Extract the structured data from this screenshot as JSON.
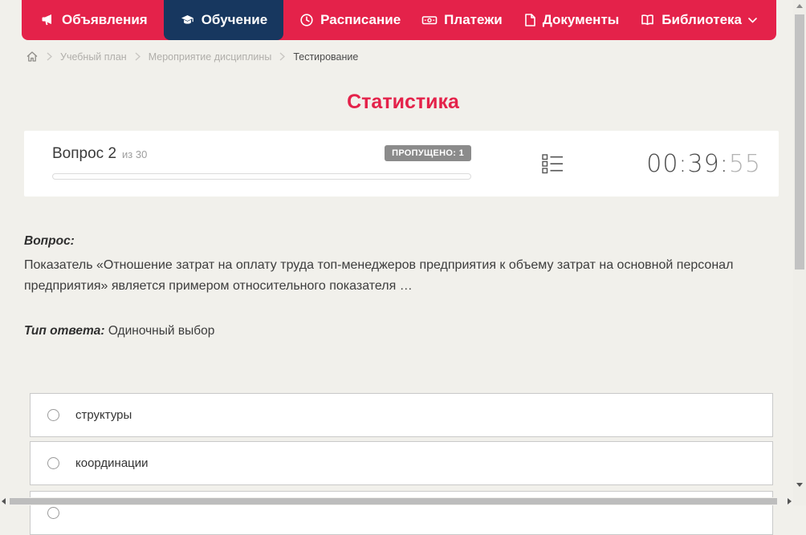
{
  "colors": {
    "accent_red": "#e4224a",
    "active_nav_navy": "#17375f",
    "badge_gray": "#8b8b8b",
    "page_bg": "#f1f0eb"
  },
  "nav": {
    "items": [
      {
        "label": "Объявления",
        "icon": "megaphone-icon",
        "active": false
      },
      {
        "label": "Обучение",
        "icon": "graduation-cap-icon",
        "active": true
      },
      {
        "label": "Расписание",
        "icon": "clock-icon",
        "active": false
      },
      {
        "label": "Платежи",
        "icon": "cash-icon",
        "active": false
      },
      {
        "label": "Документы",
        "icon": "document-icon",
        "active": false
      },
      {
        "label": "Библиотека",
        "icon": "book-icon",
        "active": false,
        "has_dropdown": true
      }
    ]
  },
  "breadcrumb": {
    "items": [
      {
        "label": "Учебный план",
        "current": false
      },
      {
        "label": "Мероприятие дисциплины",
        "current": false
      },
      {
        "label": "Тестирование",
        "current": true
      }
    ]
  },
  "page": {
    "title": "Статистика"
  },
  "question_card": {
    "question_label": "Вопрос 2",
    "question_total": "из 30",
    "skipped_badge": "ПРОПУЩЕНО: 1",
    "progress_percent": 0,
    "timer": {
      "hours_minutes": "00:39:",
      "seconds": "55"
    }
  },
  "question": {
    "prompt_label": "Вопрос:",
    "text": "Показатель «Отношение затрат на оплату труда топ-менеджеров предприятия к объему затрат на основной персонал предприятия» является примером относительного показателя …",
    "answer_type_label": "Тип ответа:",
    "answer_type_value": "Одиночный выбор"
  },
  "options": [
    {
      "label": "структуры",
      "selected": false
    },
    {
      "label": "координации",
      "selected": false
    },
    {
      "label": "",
      "selected": false,
      "partially_visible": true
    }
  ]
}
